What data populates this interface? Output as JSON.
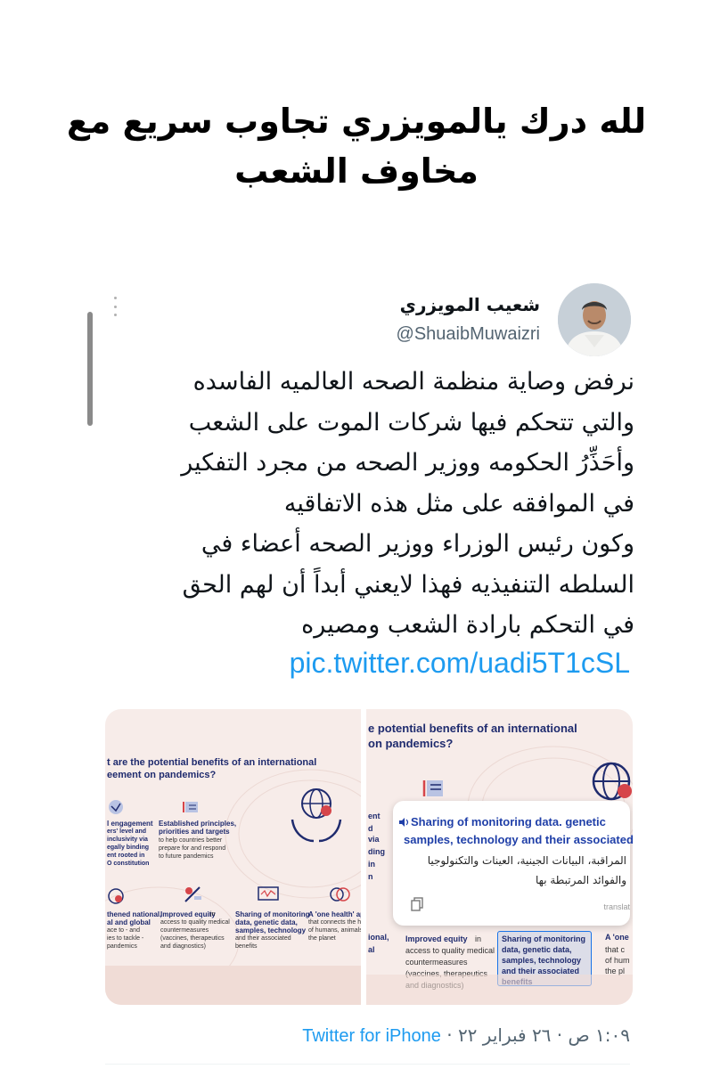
{
  "headline": {
    "line1": "لله درك يالمويزري تجاوب سريع مع",
    "line2": "مخاوف الشعب"
  },
  "tweet": {
    "author_name": "شعيب المويزري",
    "author_handle": "@ShuaibMuwaizri",
    "text_lines": [
      "نرفض وصاية منظمة الصحه العالميه الفاسده",
      "والتي تتحكم فيها شركات الموت على الشعب",
      "وأحَذِّرُ الحكومه ووزير الصحه من مجرد التفكير",
      "في الموافقه على مثل هذه الاتفاقيه",
      "وكون رئيس الوزراء ووزير الصحه أعضاء في",
      "السلطه التنفيذيه فهذا لايعني أبداً أن لهم الحق",
      "في التحكم بارادة الشعب ومصيره"
    ],
    "link": "pic.twitter.com/uadi5T1cSL",
    "timestamp": "١:٠٩ ص · ٢٦ فبراير ٢٢ ·",
    "source": "Twitter for iPhone"
  },
  "media": {
    "left_image": {
      "title_line1": "t are the potential benefits of an international",
      "title_line2": "eement on pandemics?",
      "features": [
        {
          "title": "l engagement",
          "desc": "ers' level and\ninclusivity via\negally binding\nent rooted in\nO constitution"
        },
        {
          "title": "Established principles,\npriorities and targets",
          "desc": "to help countries better\nprepare for and respond\nto future pandemics"
        },
        {
          "title": "thened national,\nal and global",
          "desc": "ace to - and\nies to tackle -\npandemics"
        },
        {
          "title": "Improved equity",
          "desc": "in\naccess to quality medical\ncountermeasures\n(vaccines, therapeutics\nand diagnostics)"
        },
        {
          "title": "Sharing of monitoring\ndata, genetic data,\nsamples, technology",
          "desc": "and their associated\nbenefits"
        },
        {
          "title": "A 'one health' appr",
          "desc": "that connects the h\nof humans, animals\nthe planet"
        }
      ]
    },
    "right_image": {
      "title_line1": "e potential benefits of an international",
      "title_line2": "on pandemics?",
      "left_fragments": [
        "ent",
        "d",
        "via",
        "ding",
        "in",
        "n"
      ],
      "popup_en_line1": "Sharing of monitoring data. genetic",
      "popup_en_line2": "samples, technology and their associated",
      "popup_ar_line1": "المراقبة، البيانات الجينية، العينات والتكنولوجيا",
      "popup_ar_line2": "والفوائد المرتبطة بها",
      "popup_footer": "translat",
      "bottom_left_1": "ional,",
      "bottom_left_2": "al",
      "equity_title": "Improved equity",
      "equity_desc": "in\naccess to quality medical\ncountermeasures\n(vaccines, therapeutics\nand diagnostics)",
      "sharing_text": "Sharing of monitoring\ndata, genetic data,\nsamples, technology\nand their associated\nbenefits",
      "one_health_title": "A 'one",
      "one_health_desc": "that c\nof hum\nthe pl"
    }
  },
  "colors": {
    "link": "#1d9bf0",
    "muted": "#536471",
    "infographic_bg": "#f7ece9",
    "infographic_title": "#1f2b6e",
    "icon_red": "#d6454a"
  }
}
